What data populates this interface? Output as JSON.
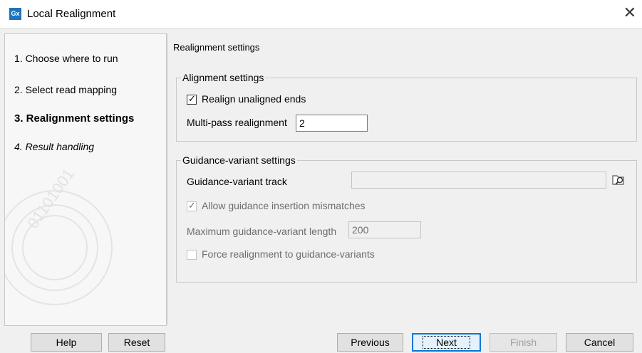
{
  "window": {
    "title": "Local Realignment",
    "app_icon": "Gx"
  },
  "steps": [
    {
      "label": "1.  Choose where to run"
    },
    {
      "label": "2.  Select read mapping"
    },
    {
      "label": "3.  Realignment settings"
    },
    {
      "label": "4.  Result handling"
    }
  ],
  "page": {
    "title": "Realignment settings"
  },
  "alignment": {
    "legend": "Alignment settings",
    "realign_label": "Realign unaligned ends",
    "multipass_label": "Multi-pass realignment",
    "multipass_value": "2"
  },
  "guidance": {
    "legend": "Guidance-variant settings",
    "track_label": "Guidance-variant track",
    "track_value": "",
    "allow_mismatch_label": "Allow guidance insertion mismatches",
    "max_length_label": "Maximum guidance-variant length",
    "max_length_value": "200",
    "force_label": "Force realignment to guidance-variants"
  },
  "buttons": {
    "help": "Help",
    "reset": "Reset",
    "previous": "Previous",
    "next": "Next",
    "finish": "Finish",
    "cancel": "Cancel"
  }
}
